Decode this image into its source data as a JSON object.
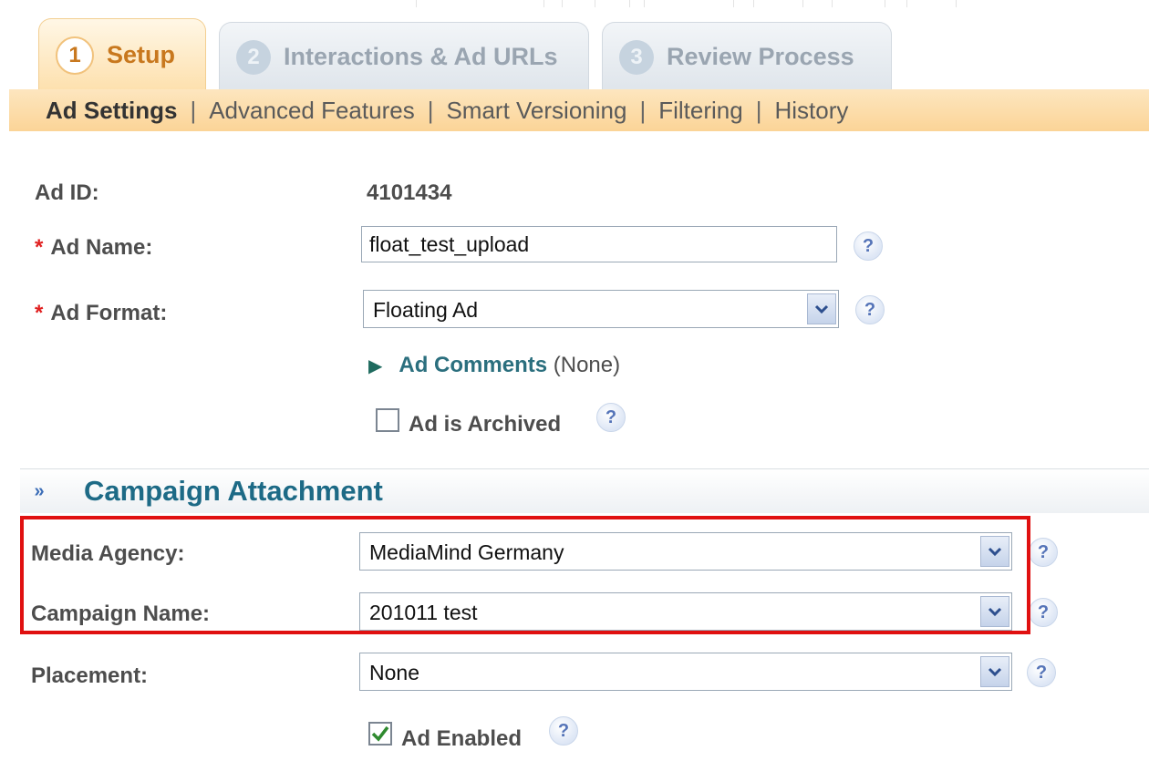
{
  "tabs": [
    {
      "num": "1",
      "label": "Setup",
      "active": true
    },
    {
      "num": "2",
      "label": "Interactions & Ad URLs",
      "active": false
    },
    {
      "num": "3",
      "label": "Review Process",
      "active": false
    }
  ],
  "subnav": {
    "items": [
      "Ad Settings",
      "Advanced Features",
      "Smart Versioning",
      "Filtering",
      "History"
    ],
    "current": "Ad Settings",
    "separator": "|"
  },
  "form": {
    "ad_id_label": "Ad ID:",
    "ad_id_value": "4101434",
    "ad_name_label": "Ad Name:",
    "ad_name_value": "float_test_upload",
    "ad_format_label": "Ad Format:",
    "ad_format_value": "Floating Ad",
    "required_marker": "*",
    "ad_comments_title": "Ad Comments",
    "ad_comments_value": "(None)",
    "archived_label": "Ad is Archived",
    "archived_checked": false
  },
  "section": {
    "title": "Campaign Attachment",
    "chevron": "»"
  },
  "campaign": {
    "media_agency_label": "Media Agency:",
    "media_agency_value": "MediaMind Germany",
    "campaign_name_label": "Campaign Name:",
    "campaign_name_value": "201011 test",
    "placement_label": "Placement:",
    "placement_value": "None",
    "enabled_label": "Ad Enabled",
    "enabled_checked": true
  },
  "help_glyph": "?",
  "colors": {
    "highlight": "#e01010",
    "active_tab": "#c8781e",
    "section_title": "#1d6a86",
    "required": "#e02020"
  }
}
